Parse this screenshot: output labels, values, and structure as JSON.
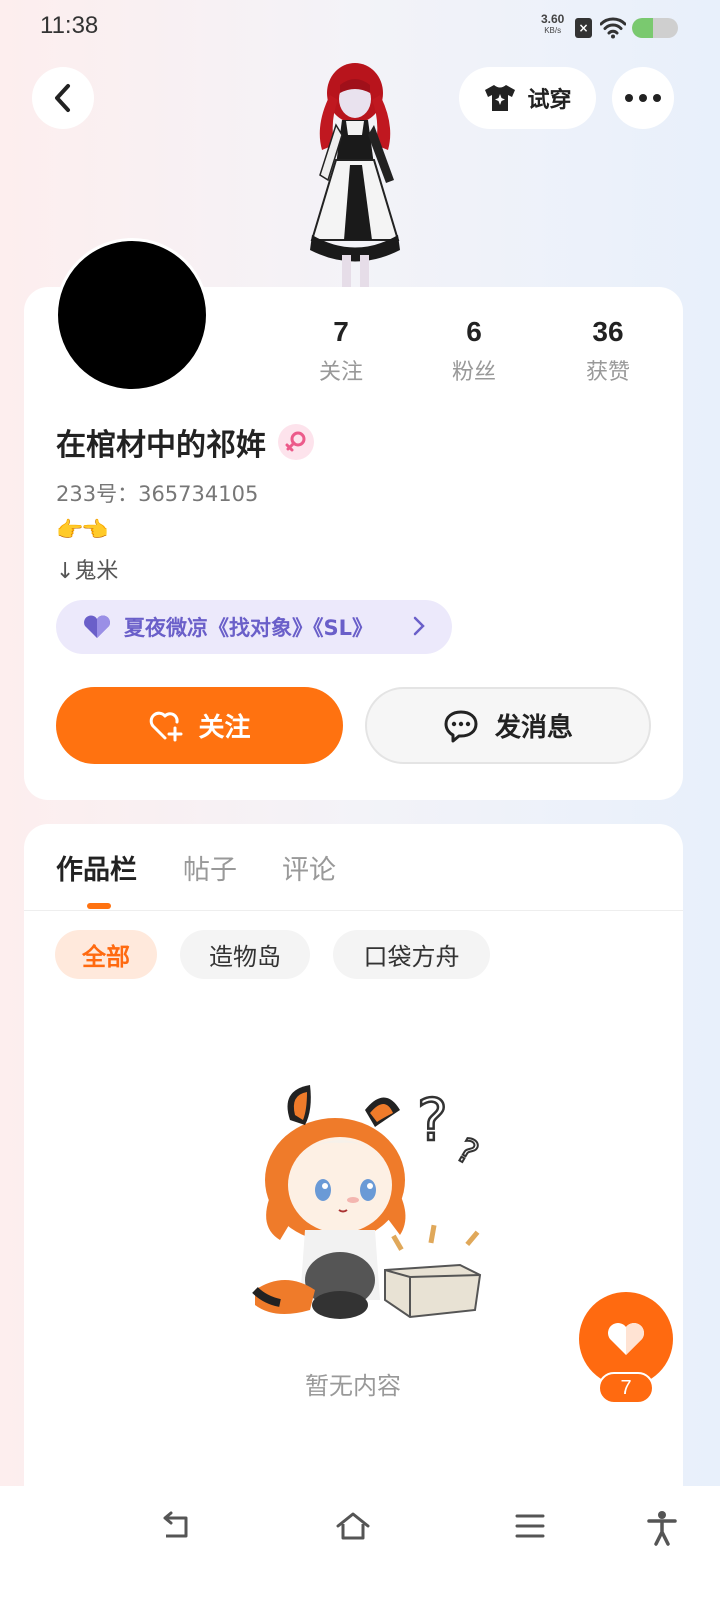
{
  "status_bar": {
    "time": "11:38",
    "net_speed_value": "3.60",
    "net_speed_unit": "KB/s",
    "sim_icon": "sim-off-icon",
    "wifi_icon": "wifi-icon",
    "battery_level": 0.45
  },
  "header": {
    "back_icon": "chevron-left-icon",
    "try_on_label": "试穿",
    "try_on_icon": "shirt-sparkle-icon",
    "more_icon": "more-dots-icon"
  },
  "profile": {
    "stats": [
      {
        "value": "7",
        "label": "关注"
      },
      {
        "value": "6",
        "label": "粉丝"
      },
      {
        "value": "36",
        "label": "获赞"
      }
    ],
    "username": "在棺材中的祁姩",
    "gender_icon": "female-icon",
    "user_id": "233号：365734105",
    "bio_emoji": "👉👈",
    "bio_text": "↓鬼米",
    "group_tag": "夏夜微凉《找对象》《SL》",
    "follow_label": "关注",
    "message_label": "发消息"
  },
  "content": {
    "tabs": [
      "作品栏",
      "帖子",
      "评论"
    ],
    "active_tab": 0,
    "filters": [
      "全部",
      "造物岛",
      "口袋方舟"
    ],
    "active_filter": 0,
    "empty_text": "暂无内容"
  },
  "like_fab": {
    "count": "7"
  },
  "nav_bar": {
    "icons": [
      "back-nav-icon",
      "home-nav-icon",
      "menu-nav-icon",
      "accessibility-icon"
    ]
  },
  "colors": {
    "accent": "#ff7210",
    "group_tag_bg": "#ece9fb",
    "group_tag_text": "#6a5fc9"
  }
}
